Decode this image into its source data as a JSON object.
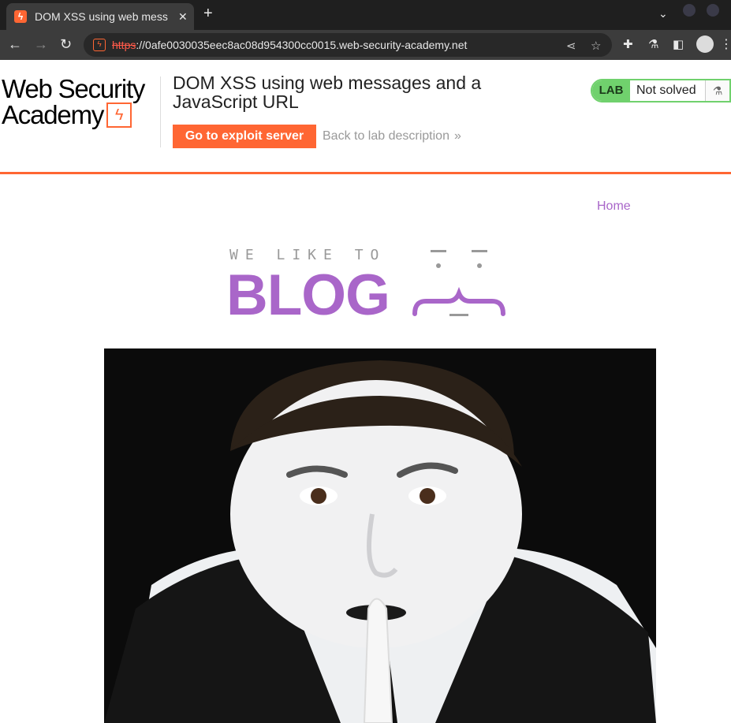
{
  "browser": {
    "tab_title": "DOM XSS using web mess",
    "tab_close": "✕",
    "new_tab": "+",
    "url_scheme": "https",
    "url_rest": "://0afe0030035eec8ac08d954300cc0015.web-security-academy.net"
  },
  "header": {
    "logo_line1": "Web Security",
    "logo_line2": "Academy",
    "title": "DOM XSS using web messages and a JavaScript URL",
    "exploit_button": "Go to exploit server",
    "back_link": "Back to lab description",
    "lab_badge": "LAB",
    "lab_status": "Not solved",
    "accent_color": "#ff6633",
    "status_color": "#70d16d"
  },
  "blog": {
    "nav_home": "Home",
    "tagline": "WE LIKE TO",
    "brand": "BLOG",
    "accent_color": "#a966c9"
  },
  "icons": {
    "back": "arrow-left-icon",
    "forward": "arrow-right-icon",
    "reload": "reload-icon",
    "share": "share-icon",
    "bookmark": "star-icon",
    "extensions": "puzzle-icon",
    "labs": "flask-icon",
    "sidepanel": "sidepanel-icon",
    "profile": "profile-icon",
    "menu": "kebab-icon"
  }
}
